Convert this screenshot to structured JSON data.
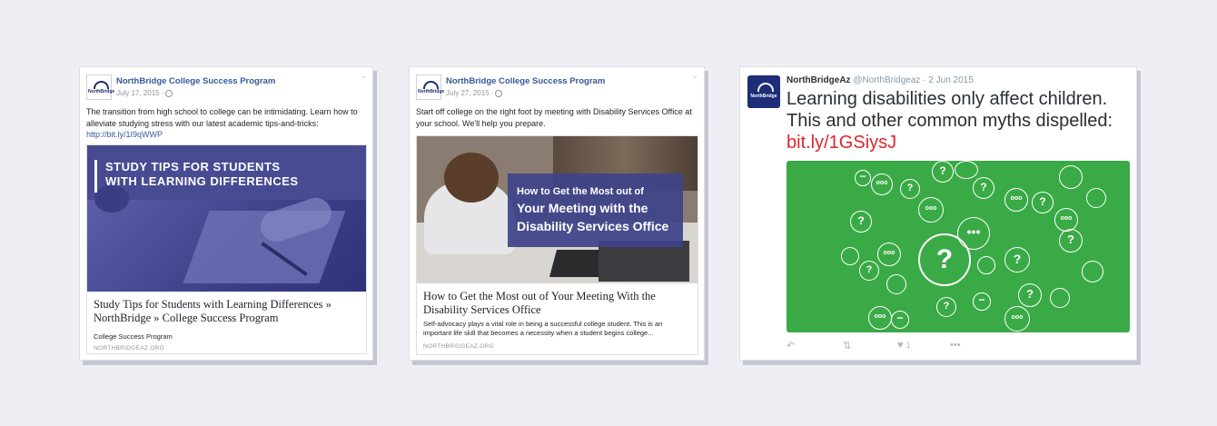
{
  "post1": {
    "page_name": "NorthBridge College Success Program",
    "logo_text": "NorthBridge",
    "date": "July 17, 2015 ·",
    "text": "The transition from high school to college can be intimidating. Learn how to alleviate studying stress with our latest academic tips-and-tricks:",
    "link": "http://bit.ly/1I9qWWP",
    "image_title_line1": "STUDY TIPS FOR STUDENTS",
    "image_title_line2": "WITH LEARNING DIFFERENCES",
    "link_title": "Study Tips for Students with Learning Differences » NorthBridge » College Success Program",
    "link_subtitle": "College Success Program",
    "link_domain": "NORTHBRIDGEAZ.ORG"
  },
  "post2": {
    "page_name": "NorthBridge College Success Program",
    "logo_text": "NorthBridge",
    "date": "July 27, 2015 ·",
    "text": "Start off college on the right foot by meeting with Disability Services Office at your school. We'll help you prepare.",
    "banner_line1": "How to Get the Most out of",
    "banner_line2": "Your Meeting with the",
    "banner_line3": "Disability Services Office",
    "link_title": "How to Get the Most out of Your Meeting With the Disability Services Office",
    "link_desc": "Self-advocacy plays a vital role in being a successful college student. This is an important life skill that becomes a necessity when a student begins college...",
    "link_domain": "NORTHBRIDGEAZ.ORG"
  },
  "tweet": {
    "name": "NorthBridgeAz",
    "handle": "@NorthBridgeaz · 2 Jun 2015",
    "avatar_text": "NorthBridge",
    "text": "Learning disabilities only affect children. This and other common myths dispelled:",
    "link": "bit.ly/1GSiysJ",
    "likes": "1",
    "image_color": "#3aaa46"
  }
}
